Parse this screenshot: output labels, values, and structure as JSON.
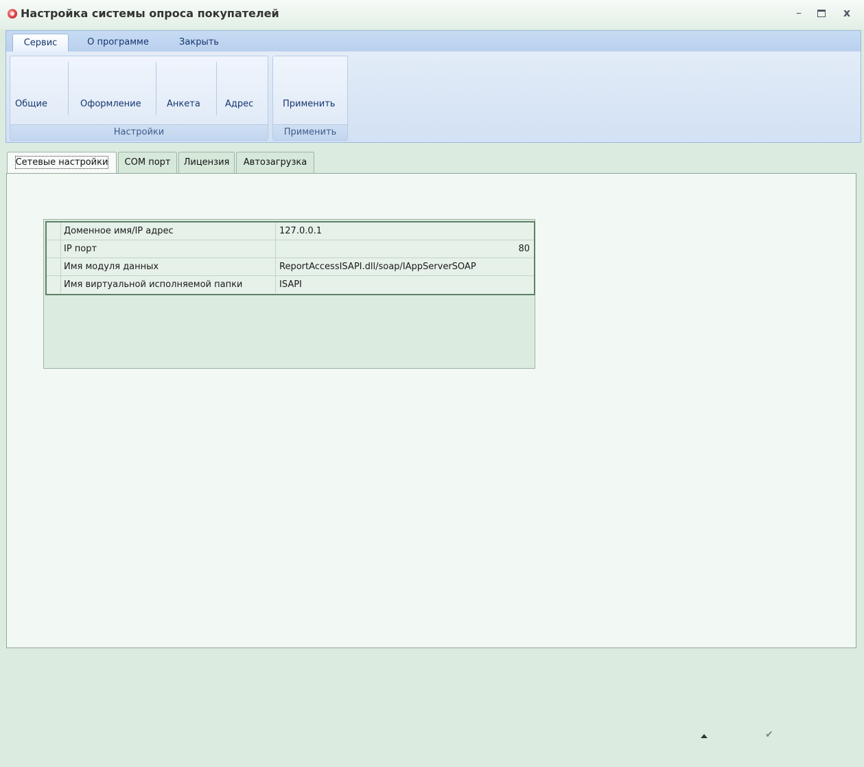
{
  "window": {
    "title": "Настройка системы опроса покупателей",
    "controls": {
      "minimize": "–",
      "close": "x"
    }
  },
  "ribbon": {
    "tabs": [
      "Сервис",
      "О программе",
      "Закрыть"
    ],
    "active_tab": "Сервис",
    "groups": [
      {
        "label": "Настройки",
        "buttons": [
          "Общие",
          "Оформление",
          "Анкета",
          "Адрес"
        ]
      },
      {
        "label": "Применить",
        "buttons": [
          "Применить"
        ]
      }
    ]
  },
  "tabs": {
    "items": [
      "Сетевые настройки",
      "COM порт",
      "Лицензия",
      "Автозагрузка"
    ],
    "active": "Сетевые настройки"
  },
  "network_settings": {
    "rows": [
      {
        "key": "Доменное имя/IP адрес",
        "value": "127.0.0.1"
      },
      {
        "key": "IP порт",
        "value": "80"
      },
      {
        "key": "Имя модуля данных",
        "value": "ReportAccessISAPI.dll/soap/IAppServerSOAP"
      },
      {
        "key": "Имя виртуальной исполняемой папки",
        "value": "ISAPI"
      }
    ]
  },
  "footer": {
    "icons": [
      "up-arrow-icon",
      "checkmark-icon"
    ],
    "check_glyph": "✔"
  }
}
